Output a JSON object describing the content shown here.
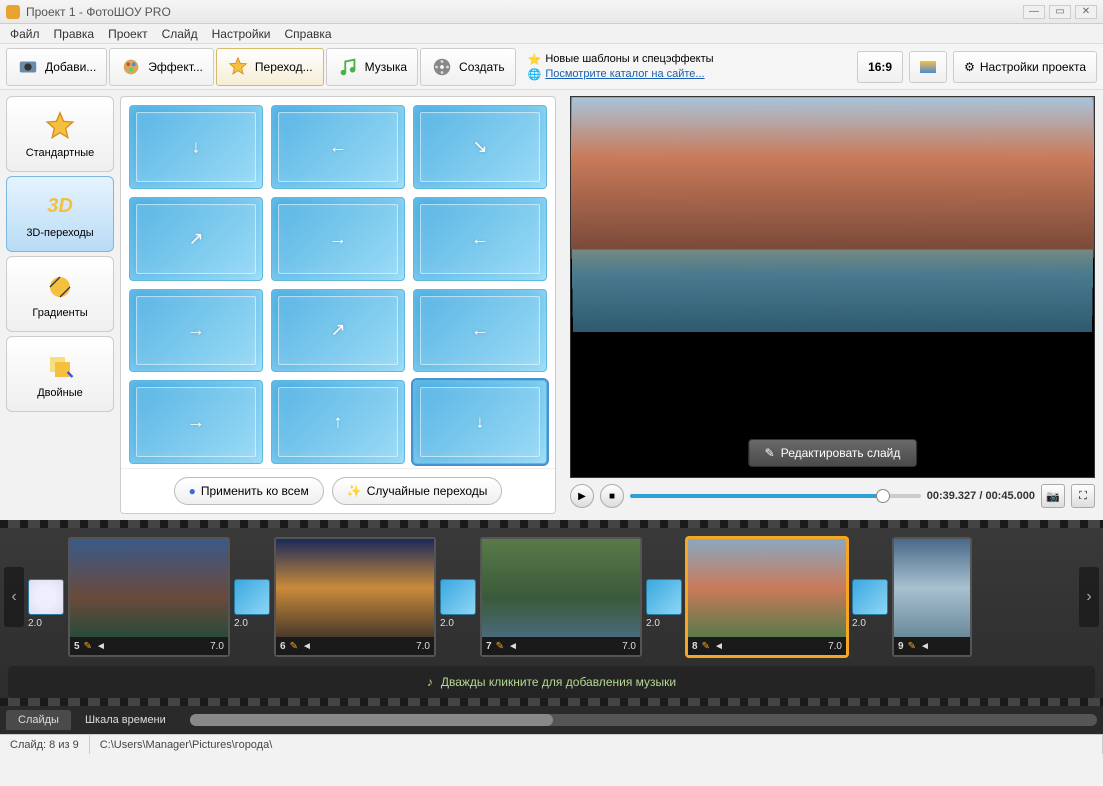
{
  "window": {
    "title": "Проект 1 - ФотоШОУ PRO"
  },
  "menu": [
    "Файл",
    "Правка",
    "Проект",
    "Слайд",
    "Настройки",
    "Справка"
  ],
  "tabs": {
    "add": "Добави...",
    "effects": "Эффект...",
    "transitions": "Переход...",
    "music": "Музыка",
    "create": "Создать"
  },
  "info": {
    "templates": "Новые шаблоны и спецэффекты",
    "catalog": "Посмотрите каталог на сайте..."
  },
  "controls": {
    "ratio": "16:9",
    "settings": "Настройки проекта"
  },
  "categories": {
    "standard": "Стандартные",
    "threed": "3D-переходы",
    "gradients": "Градиенты",
    "double": "Двойные"
  },
  "gridbuttons": {
    "applyall": "Применить ко всем",
    "random": "Случайные переходы"
  },
  "preview": {
    "edit": "Редактировать слайд",
    "time": "00:39.327 / 00:45.000"
  },
  "timeline": {
    "transitions": [
      "2.0",
      "2.0",
      "2.0",
      "2.0",
      "2.0"
    ],
    "slides": [
      {
        "num": "5",
        "dur": "7.0"
      },
      {
        "num": "6",
        "dur": "7.0"
      },
      {
        "num": "7",
        "dur": "7.0"
      },
      {
        "num": "8",
        "dur": "7.0"
      },
      {
        "num": "9"
      }
    ],
    "music": "Дважды кликните для добавления музыки",
    "tabs": {
      "slides": "Слайды",
      "timescale": "Шкала времени"
    }
  },
  "status": {
    "slide": "Слайд: 8 из 9",
    "path": "C:\\Users\\Manager\\Pictures\\города\\"
  }
}
